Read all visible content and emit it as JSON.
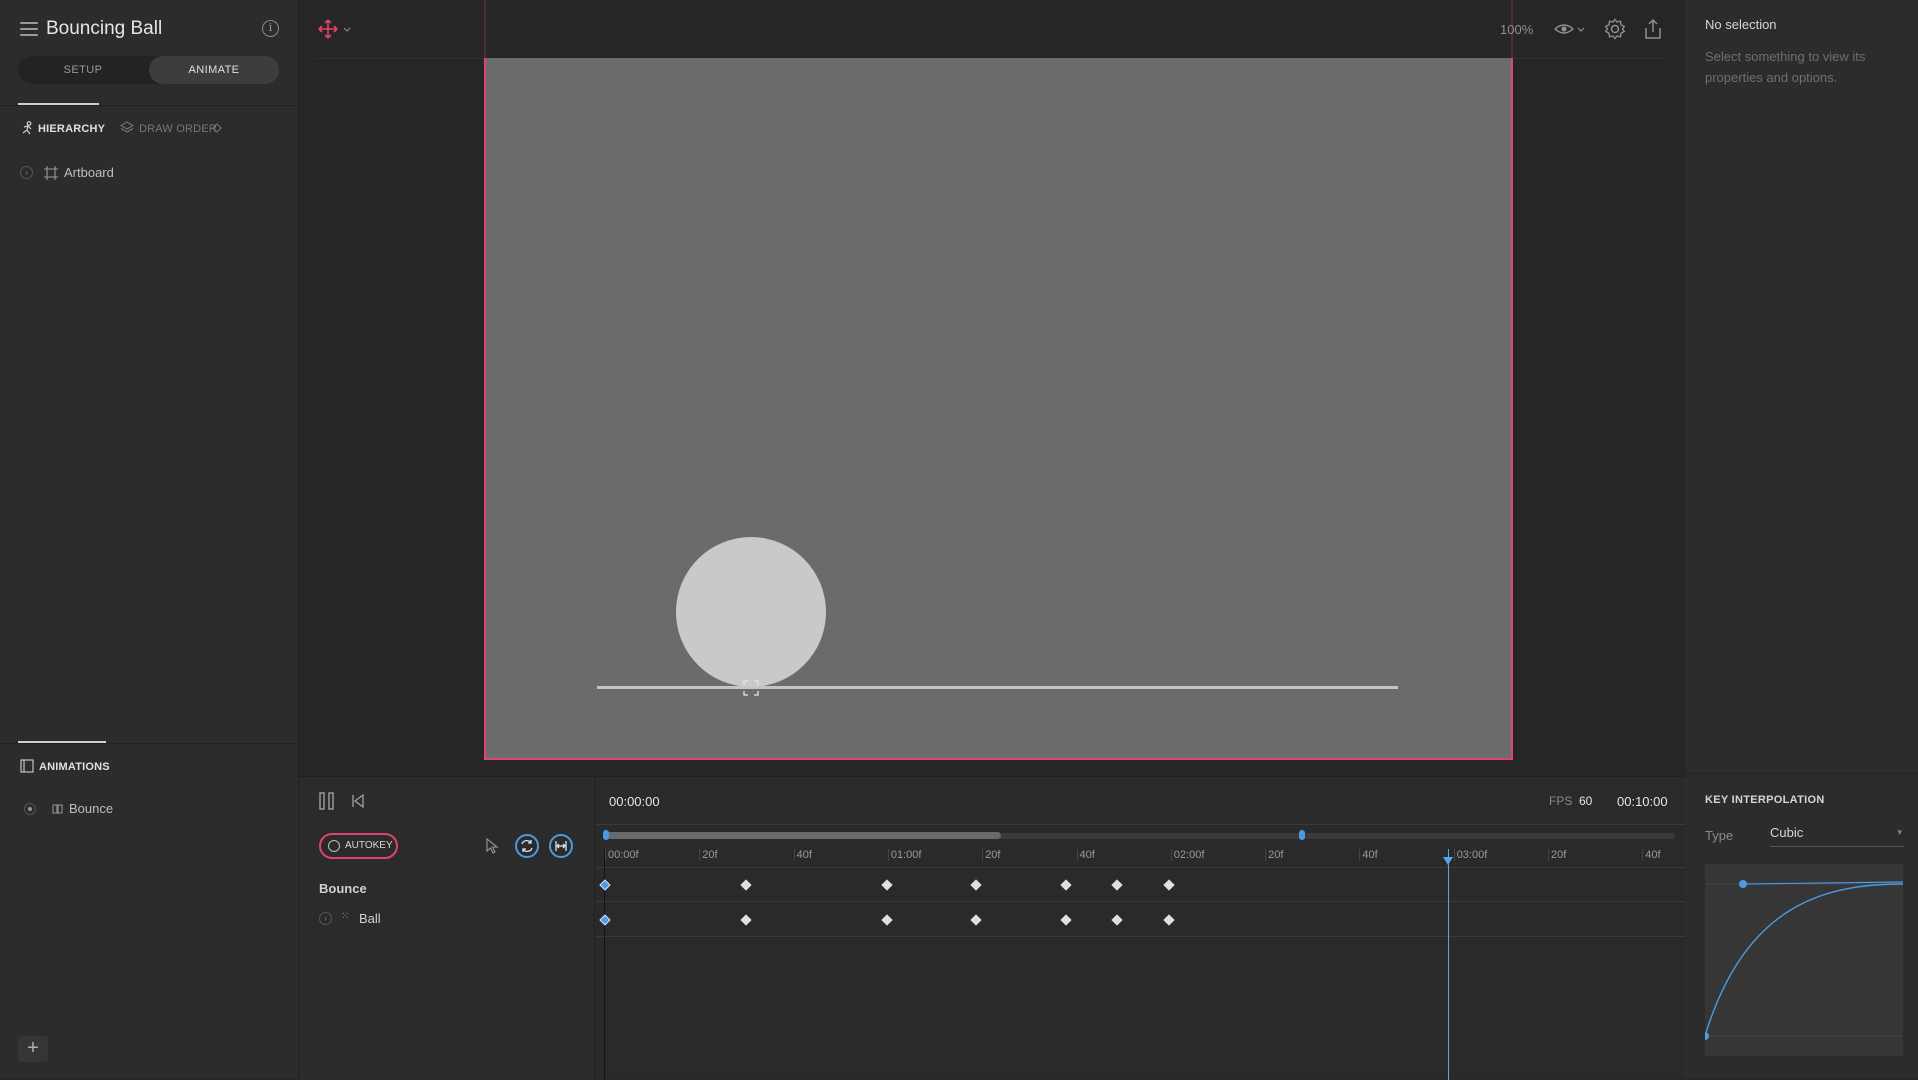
{
  "app": {
    "title": "Bouncing Ball",
    "modes": [
      "SETUP",
      "ANIMATE"
    ],
    "active_mode": "ANIMATE"
  },
  "left_panel": {
    "tabs": {
      "hierarchy": "HIERARCHY",
      "draw_order": "DRAW ORDER"
    },
    "hierarchy_items": [
      {
        "label": "Artboard"
      }
    ],
    "animations_title": "ANIMATIONS",
    "animations": [
      {
        "label": "Bounce"
      }
    ],
    "add_button": "+"
  },
  "toolbar": {
    "zoom": "100%"
  },
  "right_panel": {
    "selection_title": "No selection",
    "selection_desc": "Select something to view its properties and options.",
    "interp_title": "KEY INTERPOLATION",
    "type_label": "Type",
    "type_value": "Cubic"
  },
  "timeline": {
    "current_time": "00:00:00",
    "fps_label": "FPS",
    "fps": "60",
    "duration": "00:10:00",
    "autokey": "AUTOKEY",
    "rows": [
      {
        "label": "Bounce",
        "bold": true
      },
      {
        "label": "Ball",
        "bold": false
      }
    ],
    "ruler": [
      "00:00f",
      "20f",
      "40f",
      "01:00f",
      "20f",
      "40f",
      "02:00f",
      "20f",
      "40f",
      "03:00f",
      "20f",
      "40f"
    ]
  }
}
